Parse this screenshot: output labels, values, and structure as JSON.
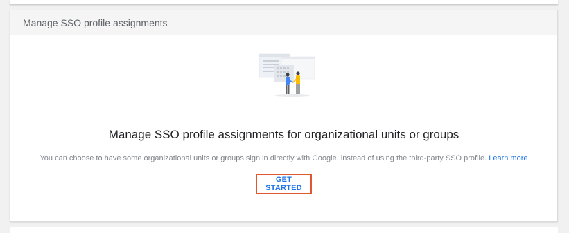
{
  "card": {
    "title": "Manage SSO profile assignments",
    "headline": "Manage SSO profile assignments for organizational units or groups",
    "description": "You can choose to have some organizational units or groups sign in directly with Google, instead of using the third-party SSO profile.",
    "learn_more_label": "Learn more",
    "cta_label": "GET STARTED"
  },
  "illustration": {
    "icon": "people-handshake-illustration"
  },
  "colors": {
    "link": "#1a73e8",
    "highlight_border": "#e4572e",
    "header_bg": "#f5f5f5",
    "page_bg": "#f1f1f1"
  }
}
